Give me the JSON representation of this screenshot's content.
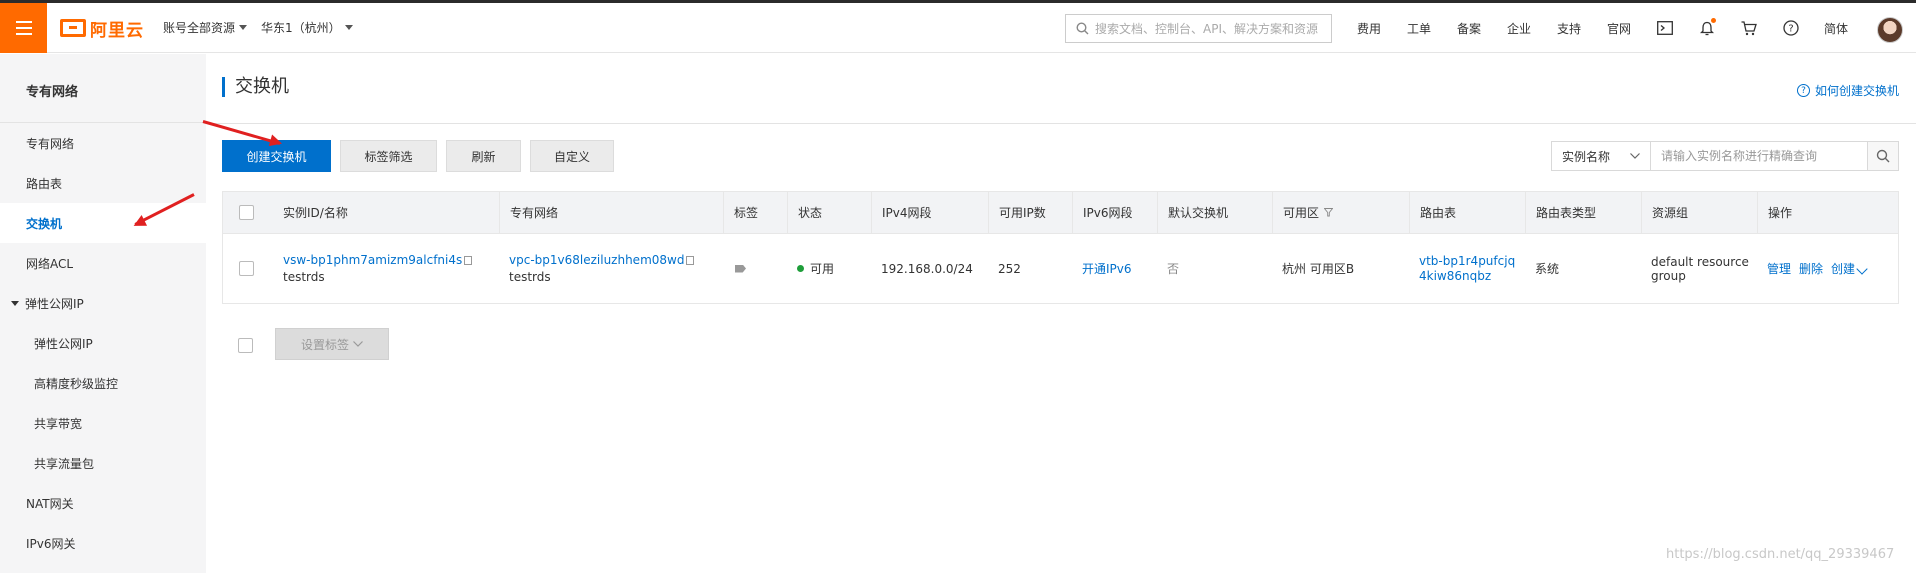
{
  "topbar": {
    "logo_text": "阿里云",
    "account_dd": "账号全部资源",
    "region_dd": "华东1（杭州）",
    "search_placeholder": "搜索文档、控制台、API、解决方案和资源",
    "links": [
      "费用",
      "工单",
      "备案",
      "企业",
      "支持",
      "官网"
    ],
    "lang": "简体",
    "icons": [
      "terminal-icon",
      "bell-icon",
      "cart-icon",
      "help-icon"
    ],
    "accent": "#ff6a00"
  },
  "sidebar": {
    "title": "专有网络",
    "items": [
      {
        "label": "专有网络",
        "level": 1,
        "active": false
      },
      {
        "label": "路由表",
        "level": 1,
        "active": false
      },
      {
        "label": "交换机",
        "level": 1,
        "active": true
      },
      {
        "label": "网络ACL",
        "level": 1,
        "active": false
      },
      {
        "label": "弹性公网IP",
        "level": 1,
        "expandable": true,
        "active": false
      },
      {
        "label": "弹性公网IP",
        "level": 2,
        "active": false
      },
      {
        "label": "高精度秒级监控",
        "level": 2,
        "active": false
      },
      {
        "label": "共享带宽",
        "level": 2,
        "active": false
      },
      {
        "label": "共享流量包",
        "level": 2,
        "active": false
      },
      {
        "label": "NAT网关",
        "level": 1,
        "active": false
      },
      {
        "label": "IPv6网关",
        "level": 1,
        "active": false
      }
    ]
  },
  "main": {
    "title": "交换机",
    "help_link": "如何创建交换机",
    "toolbar": {
      "create": "创建交换机",
      "tag_filter": "标签筛选",
      "refresh": "刷新",
      "customize": "自定义"
    },
    "filter": {
      "select_value": "实例名称",
      "input_placeholder": "请输入实例名称进行精确查询"
    },
    "table": {
      "headers": [
        "实例ID/名称",
        "专有网络",
        "标签",
        "状态",
        "IPv4网段",
        "可用IP数",
        "IPv6网段",
        "默认交换机",
        "可用区",
        "路由表",
        "路由表类型",
        "资源组",
        "操作"
      ],
      "rows": [
        {
          "id": "vsw-bp1phm7amizm9alcfni4s",
          "name": "testrds",
          "vpc_id": "vpc-bp1v68leziluzhhem08wd",
          "vpc_name": "testrds",
          "status": "可用",
          "ipv4": "192.168.0.0/24",
          "available_ips": "252",
          "ipv6": "开通IPv6",
          "default_switch": "否",
          "zone": "杭州 可用区B",
          "route_table": "vtb-bp1r4pufcjq4kiw86nqbz",
          "route_table_type": "系统",
          "resource_group": "default resource group",
          "ops": [
            "管理",
            "删除",
            "创建"
          ]
        }
      ]
    },
    "bottom_button": "设置标签"
  },
  "watermark": "https://blog.csdn.net/qq_29339467"
}
